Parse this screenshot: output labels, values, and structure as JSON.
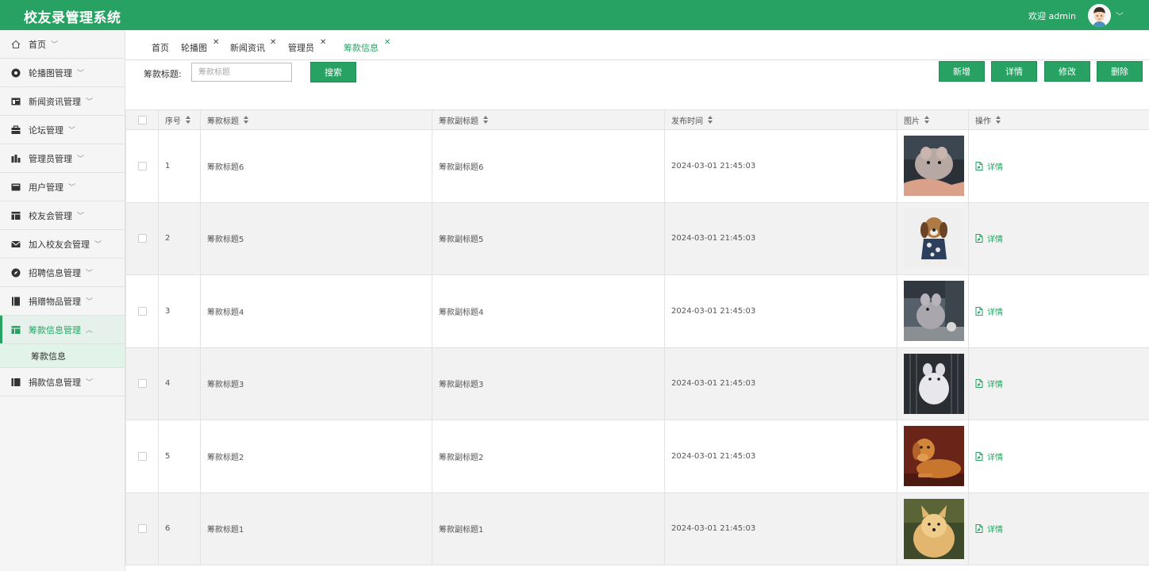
{
  "header": {
    "title": "校友录管理系统",
    "welcome": "欢迎 admin"
  },
  "sidebar": {
    "items": [
      {
        "label": "首页",
        "icon": "home-icon"
      },
      {
        "label": "轮播图管理",
        "icon": "carousel-icon"
      },
      {
        "label": "新闻资讯管理",
        "icon": "news-icon"
      },
      {
        "label": "论坛管理",
        "icon": "forum-icon"
      },
      {
        "label": "管理员管理",
        "icon": "admin-icon"
      },
      {
        "label": "用户管理",
        "icon": "user-icon"
      },
      {
        "label": "校友会管理",
        "icon": "alumni-icon"
      },
      {
        "label": "加入校友会管理",
        "icon": "mail-icon"
      },
      {
        "label": "招聘信息管理",
        "icon": "compass-icon"
      },
      {
        "label": "捐赠物品管理",
        "icon": "book-icon"
      },
      {
        "label": "筹款信息管理",
        "icon": "table-icon",
        "expanded": true
      },
      {
        "label": "捐款信息管理",
        "icon": "ledger-icon"
      }
    ],
    "subitem": "筹款信息"
  },
  "tabs": [
    {
      "label": "首页"
    },
    {
      "label": "轮播图"
    },
    {
      "label": "新闻资讯"
    },
    {
      "label": "管理员"
    },
    {
      "label": "筹款信息",
      "active": true
    }
  ],
  "search": {
    "label": "筹款标题:",
    "placeholder": "筹款标题",
    "button": "搜索"
  },
  "toolbar": {
    "add": "新增",
    "detail": "详情",
    "edit": "修改",
    "delete": "删除"
  },
  "table": {
    "columns": {
      "no": "序号",
      "title": "筹款标题",
      "subtitle": "筹款副标题",
      "time": "发布时间",
      "image": "图片",
      "action": "操作"
    },
    "action_label": "详情",
    "rows": [
      {
        "no": "1",
        "title": "筹款标题6",
        "subtitle": "筹款副标题6",
        "time": "2024-03-01 21:45:03",
        "image": "chinchilla-in-hand-photo"
      },
      {
        "no": "2",
        "title": "筹款标题5",
        "subtitle": "筹款副标题5",
        "time": "2024-03-01 21:45:03",
        "image": "beagle-in-jacket-photo"
      },
      {
        "no": "3",
        "title": "筹款标题4",
        "subtitle": "筹款副标题4",
        "time": "2024-03-01 21:45:03",
        "image": "grey-chinchilla-photo"
      },
      {
        "no": "4",
        "title": "筹款标题3",
        "subtitle": "筹款副标题3",
        "time": "2024-03-01 21:45:03",
        "image": "white-chinchilla-photo"
      },
      {
        "no": "5",
        "title": "筹款标题2",
        "subtitle": "筹款副标题2",
        "time": "2024-03-01 21:45:03",
        "image": "golden-retriever-photo"
      },
      {
        "no": "6",
        "title": "筹款标题1",
        "subtitle": "筹款副标题1",
        "time": "2024-03-01 21:45:03",
        "image": "fluffy-spitz-photo"
      }
    ]
  },
  "colors": {
    "brand": "#27a263"
  }
}
